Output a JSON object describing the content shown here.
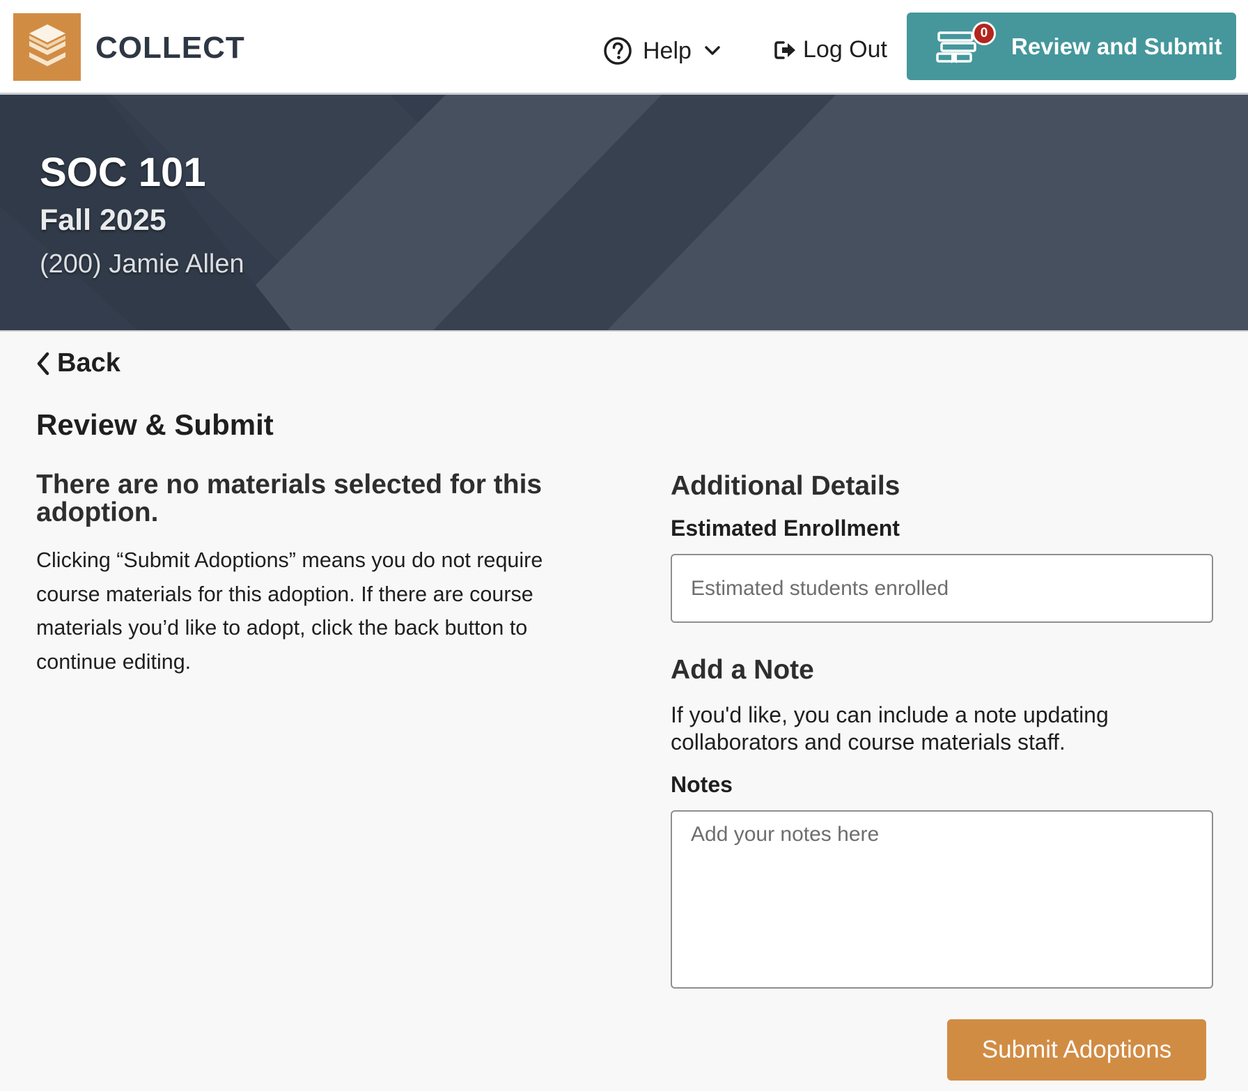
{
  "header": {
    "brand": "COLLECT",
    "help_label": "Help",
    "logout_label": "Log Out",
    "review_button_label": "Review and Submit",
    "cart_count": "0"
  },
  "banner": {
    "course_code": "SOC 101",
    "term": "Fall 2025",
    "section_instructor": "(200) Jamie Allen"
  },
  "nav": {
    "back_label": "Back"
  },
  "main": {
    "page_title": "Review & Submit",
    "no_materials_heading": "There are no materials selected for this adoption.",
    "explanation": "Clicking “Submit Adoptions” means you do not require course materials for this adoption. If there are course materials you’d like to adopt, click the back button to continue editing."
  },
  "details": {
    "title": "Additional Details",
    "enrollment_label": "Estimated Enrollment",
    "enrollment_placeholder": "Estimated students enrolled",
    "enrollment_value": "",
    "note_title": "Add a Note",
    "note_description": "If you'd like, you can include a note updating collaborators and course materials staff.",
    "notes_label": "Notes",
    "notes_placeholder": "Add your notes here",
    "notes_value": ""
  },
  "actions": {
    "submit_label": "Submit Adoptions"
  },
  "colors": {
    "brand_orange": "#d18c44",
    "teal": "#45979c",
    "banner_dark": "#333d4d",
    "badge_red": "#b3261e"
  },
  "icons": {
    "logo": "layers-stack-icon",
    "help": "question-circle-icon",
    "help_dropdown": "chevron-down-icon",
    "logout": "sign-out-icon",
    "cart": "book-cart-icon",
    "back": "chevron-left-icon"
  }
}
